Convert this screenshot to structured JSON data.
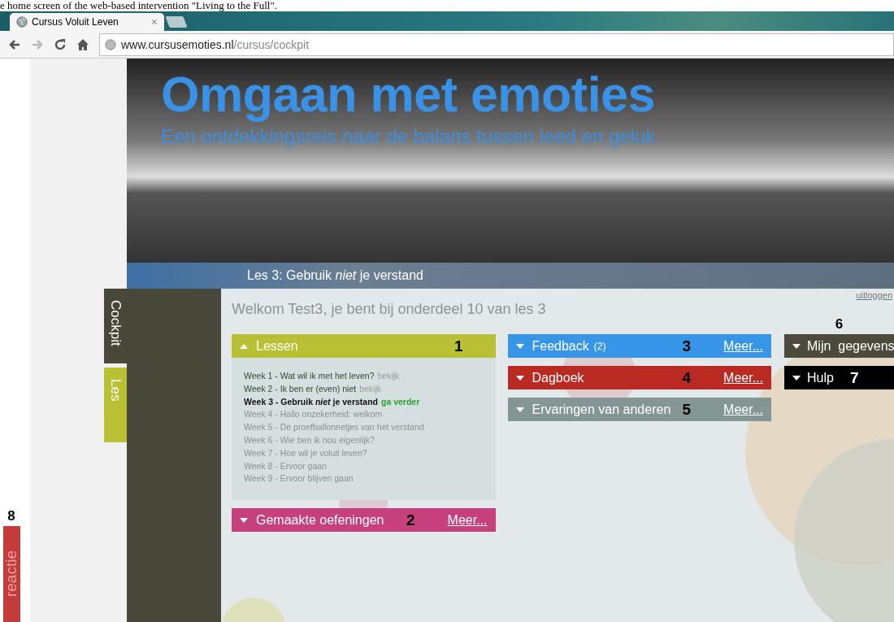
{
  "caption": "e home screen of the web-based intervention \"Living to the Full\".",
  "browser": {
    "tab_title": "Cursus Voluit Leven",
    "close": "×",
    "url_host": "www.cursusemoties.nl",
    "url_path": "/cursus/cockpit",
    "forward_disabled": true
  },
  "banner": {
    "title": "Omgaan met emoties",
    "subtitle": "Een ontdekkingsreis naar de balans tussen leed en geluk"
  },
  "lesson_bar": "Les 3: Gebruik *niet* je verstand",
  "side_tabs": [
    {
      "label": "Cockpit",
      "selected": true
    },
    {
      "label": "Les",
      "selected": false
    }
  ],
  "feedback_tab": {
    "label": "reactie",
    "marker": "8"
  },
  "logout": "uitloggen",
  "welcome": "Welkom Test3, je bent bij onderdeel 10 van les 3",
  "columns": [
    [
      {
        "title": "Lessen",
        "expanded": true,
        "color": "#b9c033",
        "marker": "1",
        "lessons": [
          {
            "week": "Week 1 - ",
            "title": "Wat wil ik met het leven?",
            "kind": "done",
            "action": "bekijk"
          },
          {
            "week": "Week 2 - ",
            "title": "Ik ben er (even) niet",
            "kind": "done",
            "action": "bekijk"
          },
          {
            "week": "Week 3 - ",
            "title": "Gebruik *niet* je verstand",
            "kind": "current",
            "action": "ga verder"
          },
          {
            "week": "Week 4 - ",
            "title": "Hallo onzekerheid: welkom",
            "kind": "locked"
          },
          {
            "week": "Week 5 - ",
            "title": "De proefballonnetjes van het verstand",
            "kind": "locked"
          },
          {
            "week": "Week 6 - ",
            "title": "Wie ben ik nou eigenlijk?",
            "kind": "locked"
          },
          {
            "week": "Week 7 - ",
            "title": "Hoe wil je voluit leven?",
            "kind": "locked"
          },
          {
            "week": "Week 8 - ",
            "title": "Ervoor gaan",
            "kind": "locked"
          },
          {
            "week": "Week 9 - ",
            "title": "Ervoor blijven gaan",
            "kind": "locked"
          }
        ]
      },
      {
        "title": "Gemaakte oefeningen",
        "expanded": false,
        "color": "#c6407c",
        "marker": "2",
        "more": "Meer..."
      }
    ],
    [
      {
        "title": "Feedback",
        "count": "(2)",
        "expanded": false,
        "color": "#3795e8",
        "marker": "3",
        "more": "Meer..."
      },
      {
        "title": "Dagboek",
        "expanded": false,
        "color": "#bb2a22",
        "marker": "4",
        "more": "Meer..."
      },
      {
        "title": "Ervaringen van anderen",
        "expanded": false,
        "color": "#849694",
        "marker": "5",
        "more": "Meer..."
      }
    ],
    [
      {
        "title": "Mijn  gegevens",
        "expanded": false,
        "color": "#4b4a3b",
        "marker": "6",
        "marker_above": true
      },
      {
        "title": "Hulp",
        "expanded": false,
        "color": "#000000",
        "marker": "7",
        "marker_inverted": true
      }
    ]
  ]
}
